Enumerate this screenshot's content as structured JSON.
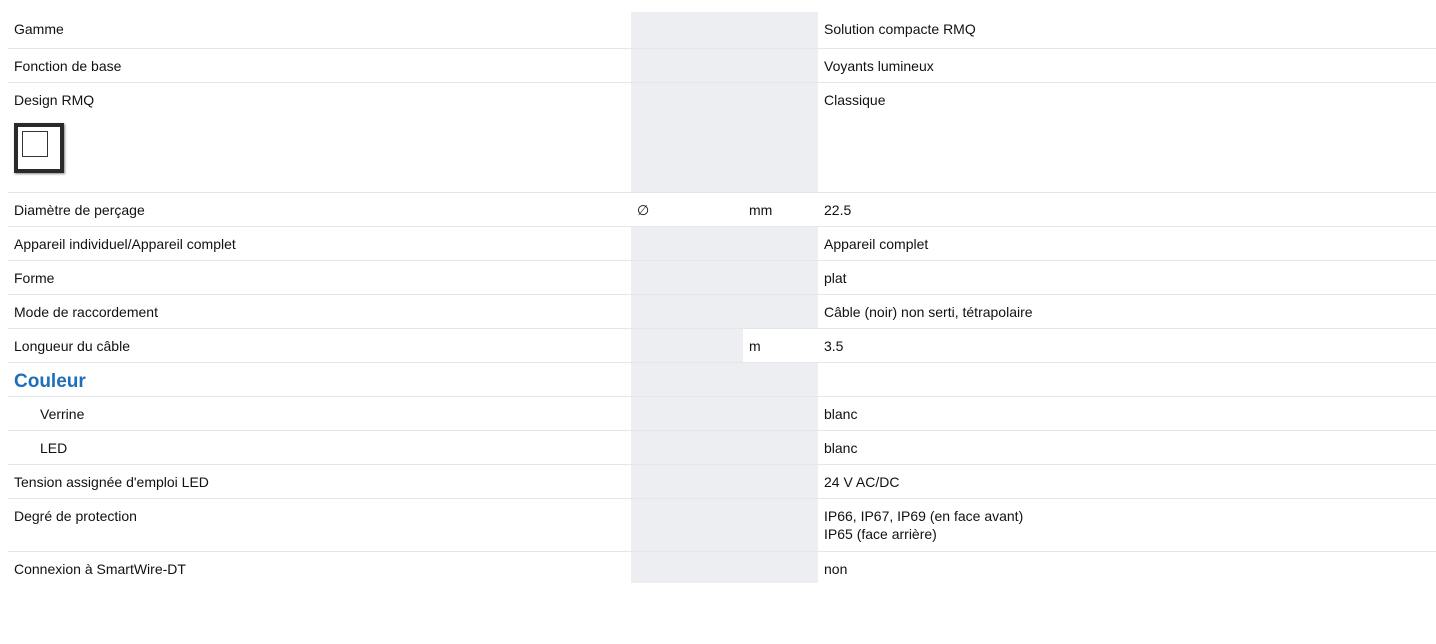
{
  "colors": {
    "accent": "#1e6fb8",
    "shade": "#eceef1",
    "rule": "#e4e6ea"
  },
  "rows": [
    {
      "label": "Gamme",
      "symbol": "",
      "unit": "",
      "value": "Solution compacte RMQ"
    },
    {
      "label": "Fonction de base",
      "symbol": "",
      "unit": "",
      "value": "Voyants lumineux"
    },
    {
      "label": "Design RMQ",
      "symbol": "",
      "unit": "",
      "value": "Classique",
      "icon": "rmq-classic-design-icon"
    },
    {
      "label": "Diamètre de perçage",
      "symbol": "∅",
      "unit": "mm",
      "value": "22.5"
    },
    {
      "label": "Appareil individuel/Appareil complet",
      "symbol": "",
      "unit": "",
      "value": "Appareil complet"
    },
    {
      "label": "Forme",
      "symbol": "",
      "unit": "",
      "value": "plat"
    },
    {
      "label": "Mode de raccordement",
      "symbol": "",
      "unit": "",
      "value": "Câble (noir) non serti, tétrapolaire"
    },
    {
      "label": "Longueur du câble",
      "symbol": "",
      "unit": "m",
      "value": "3.5"
    },
    {
      "section": "Couleur"
    },
    {
      "label": "Verrine",
      "symbol": "",
      "unit": "",
      "value": "blanc",
      "sub": true
    },
    {
      "label": "LED",
      "symbol": "",
      "unit": "",
      "value": "blanc",
      "sub": true
    },
    {
      "label": "Tension assignée d'emploi LED",
      "symbol": "",
      "unit": "",
      "value": "24 V AC/DC"
    },
    {
      "label": "Degré de protection",
      "symbol": "",
      "unit": "",
      "value": "IP66, IP67, IP69 (en face avant)",
      "value2": "IP65 (face arrière)"
    },
    {
      "label": "Connexion à SmartWire-DT",
      "symbol": "",
      "unit": "",
      "value": "non"
    }
  ]
}
